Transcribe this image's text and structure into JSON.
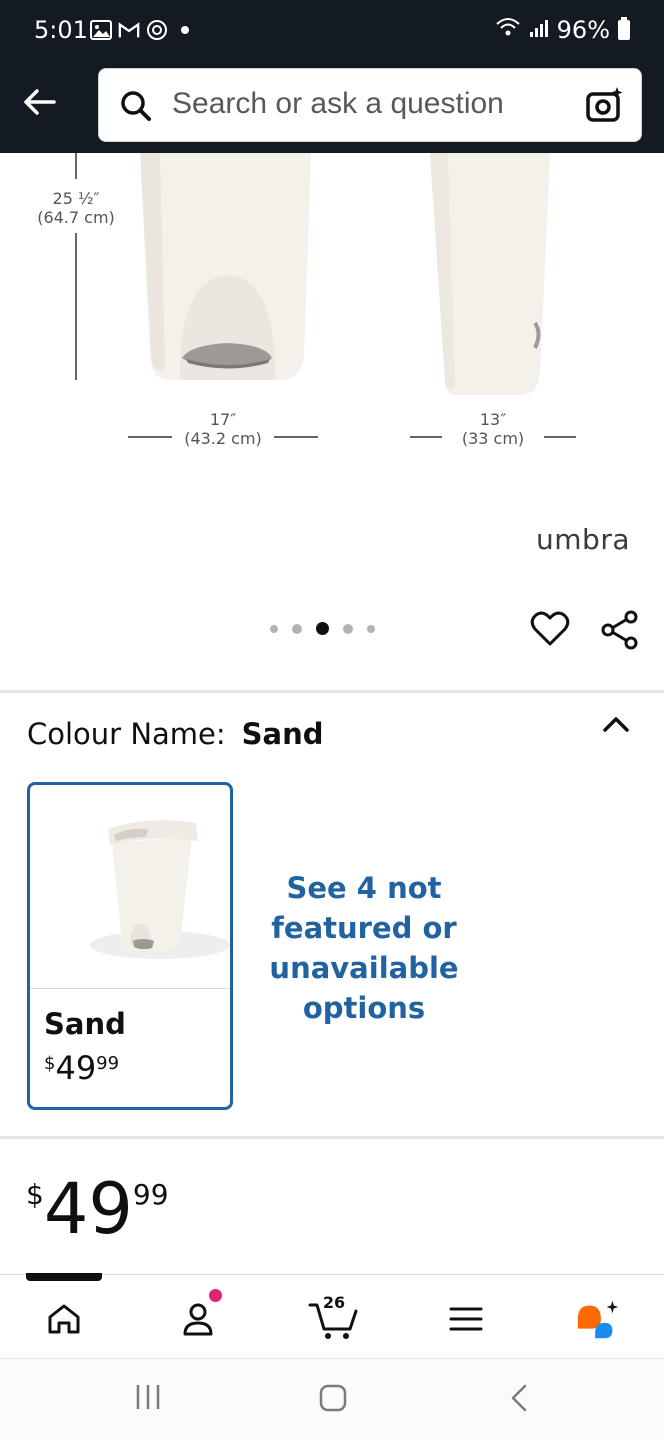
{
  "status_bar": {
    "time": "5:01",
    "battery": "96%",
    "icons": [
      "gallery-icon",
      "gmail-icon",
      "sync-icon",
      "dot-icon",
      "wifi-icon",
      "signal-icon",
      "battery-icon"
    ]
  },
  "header": {
    "back_icon": "arrow-left-icon",
    "search_placeholder": "Search or ask a question",
    "camera_icon": "camera-search-icon"
  },
  "product_image": {
    "height_label_1": "25 ½″",
    "height_label_2": "(64.7 cm)",
    "width_label_1": "17″",
    "width_label_2": "(43.2 cm)",
    "depth_label_1": "13″",
    "depth_label_2": "(33 cm)",
    "brand": "umbra",
    "carousel_total": 5,
    "carousel_active_index": 2
  },
  "colour": {
    "label": "Colour Name:",
    "value": "Sand",
    "swatches": [
      {
        "name": "Sand",
        "price_symbol": "$",
        "price_whole": "49",
        "price_fraction": "99"
      }
    ],
    "more_options": "See 4 not featured or unavailable options"
  },
  "price": {
    "symbol": "$",
    "whole": "49",
    "fraction": "99"
  },
  "bottom_nav": {
    "items": [
      "home-icon",
      "account-icon",
      "cart-icon",
      "menu-icon",
      "rufus-icon"
    ],
    "cart_count": "26"
  },
  "colors": {
    "header_bg": "#131a22",
    "link_blue": "#2162a1",
    "notification": "#e0256f",
    "rufus_orange": "#ff6a00",
    "rufus_blue": "#1a8cf0"
  }
}
